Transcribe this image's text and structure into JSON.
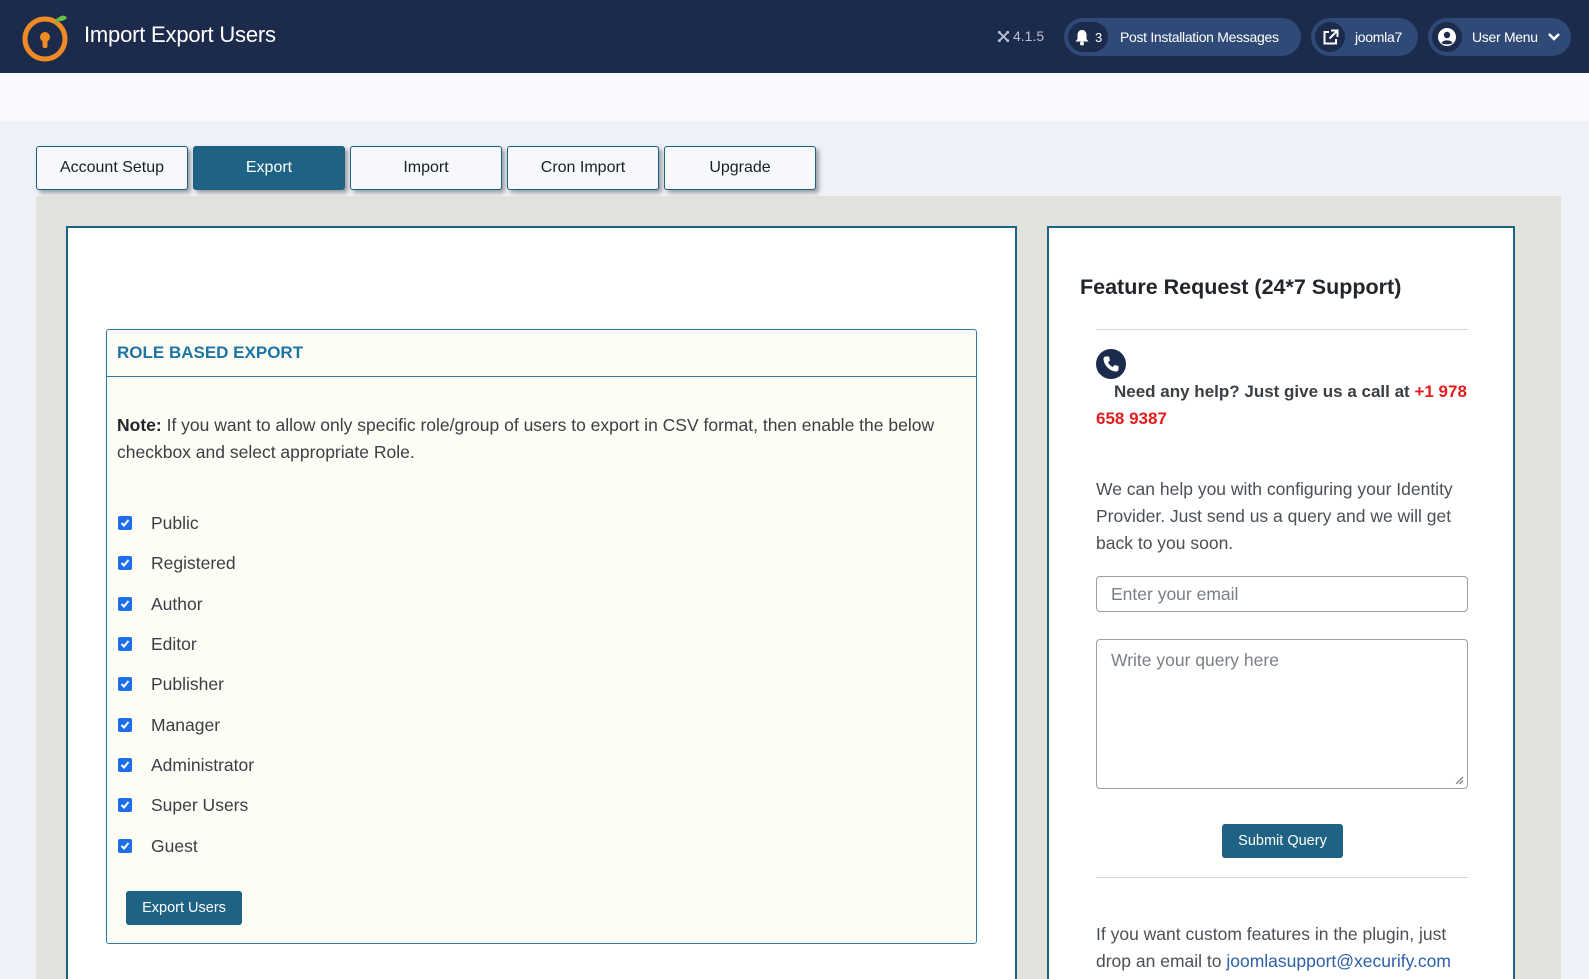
{
  "header": {
    "title": "Import Export Users",
    "version": "4.1.5",
    "notifications": {
      "count": "3",
      "label": "Post Installation Messages"
    },
    "site_link": "joomla7",
    "user_menu": "User Menu"
  },
  "tabs": [
    {
      "label": "Account Setup",
      "active": false
    },
    {
      "label": "Export",
      "active": true
    },
    {
      "label": "Import",
      "active": false
    },
    {
      "label": "Cron Import",
      "active": false
    },
    {
      "label": "Upgrade",
      "active": false
    }
  ],
  "export": {
    "heading": "ROLE BASED EXPORT",
    "note_label": "Note:",
    "note_text": " If you want to allow only specific role/group of users to export in CSV format, then enable the below checkbox and select appropriate Role.",
    "roles": [
      {
        "label": "Public",
        "checked": true
      },
      {
        "label": "Registered",
        "checked": true
      },
      {
        "label": "Author",
        "checked": true
      },
      {
        "label": "Editor",
        "checked": true
      },
      {
        "label": "Publisher",
        "checked": true
      },
      {
        "label": "Manager",
        "checked": true
      },
      {
        "label": "Administrator",
        "checked": true
      },
      {
        "label": "Super Users",
        "checked": true
      },
      {
        "label": "Guest",
        "checked": true
      }
    ],
    "button_label": "Export Users"
  },
  "support": {
    "title": "Feature Request (24*7 Support)",
    "help_text": "Need any help? Just give us a call at ",
    "phone": "+1 978 658 9387",
    "description": "We can help you with configuring your Identity Provider. Just send us a query and we will get back to you soon.",
    "email_placeholder": "Enter your email",
    "query_placeholder": "Write your query here",
    "submit_label": "Submit Query",
    "custom_text": "If you want custom features in the plugin, just drop an email to ",
    "custom_email": "joomlasupport@xecurify.com"
  },
  "colors": {
    "header_bg": "#1c2b4b",
    "accent": "#1f6384",
    "heading_blue": "#1d74a5",
    "phone_red": "#e11d1d",
    "checkbox_blue": "#1d6ee8"
  }
}
